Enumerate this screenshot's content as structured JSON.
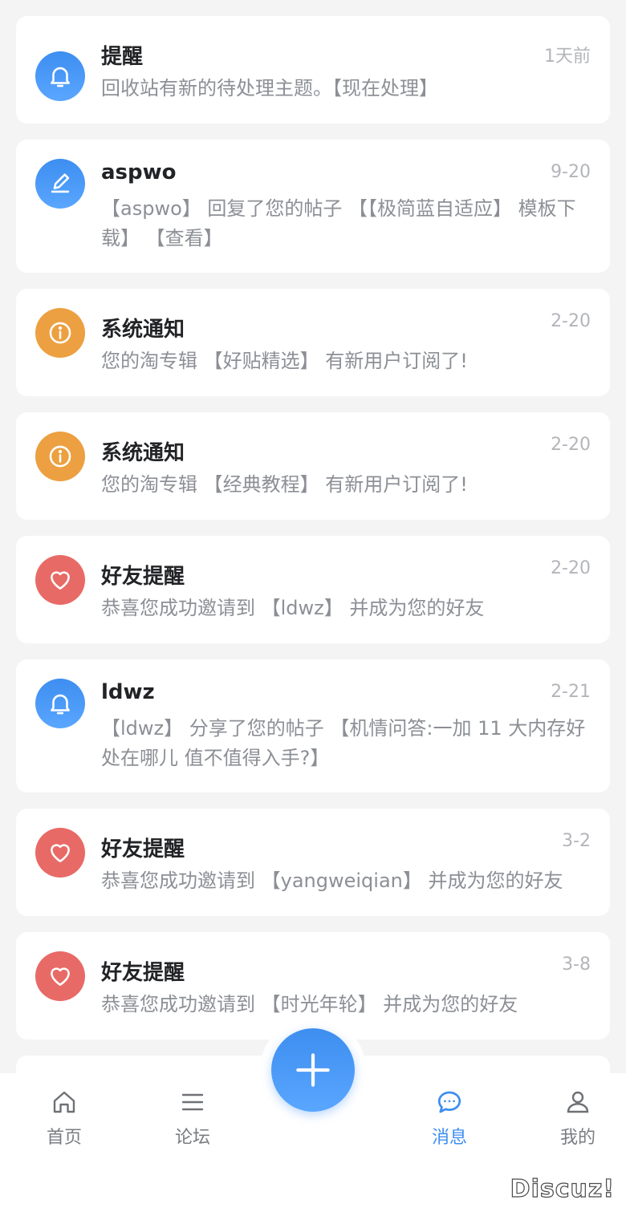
{
  "notifications": [
    {
      "type": "bell",
      "color": "#3d8ef0",
      "title": "提醒",
      "time": "1天前",
      "body": "回收站有新的待处理主题。【现在处理】"
    },
    {
      "type": "pen",
      "color": "#3d8ef0",
      "title": "aspwo",
      "time": "9-20",
      "body": "【aspwo】 回复了您的帖子 【【极简蓝自适应】 模板下载】 【查看】"
    },
    {
      "type": "info",
      "color": "#eca041",
      "title": "系统通知",
      "time": "2-20",
      "body": "您的淘专辑 【好贴精选】 有新用户订阅了!"
    },
    {
      "type": "info",
      "color": "#eca041",
      "title": "系统通知",
      "time": "2-20",
      "body": "您的淘专辑 【经典教程】 有新用户订阅了!"
    },
    {
      "type": "heart",
      "color": "#e86a66",
      "title": "好友提醒",
      "time": "2-20",
      "body": "恭喜您成功邀请到 【ldwz】 并成为您的好友"
    },
    {
      "type": "bell",
      "color": "#3d8ef0",
      "title": "ldwz",
      "time": "2-21",
      "body": "【ldwz】 分享了您的帖子 【机情问答:一加 11 大内存好处在哪儿 值不值得入手?】"
    },
    {
      "type": "heart",
      "color": "#e86a66",
      "title": "好友提醒",
      "time": "3-2",
      "body": "恭喜您成功邀请到 【yangweiqian】 并成为您的好友"
    },
    {
      "type": "heart",
      "color": "#e86a66",
      "title": "好友提醒",
      "time": "3-8",
      "body": "恭喜您成功邀请到 【时光年轮】 并成为您的好友"
    }
  ],
  "tabbar": {
    "home": "首页",
    "forum": "论坛",
    "messages": "消息",
    "mine": "我的",
    "active_color": "#3d8ef0"
  },
  "watermark": "Discuz!"
}
